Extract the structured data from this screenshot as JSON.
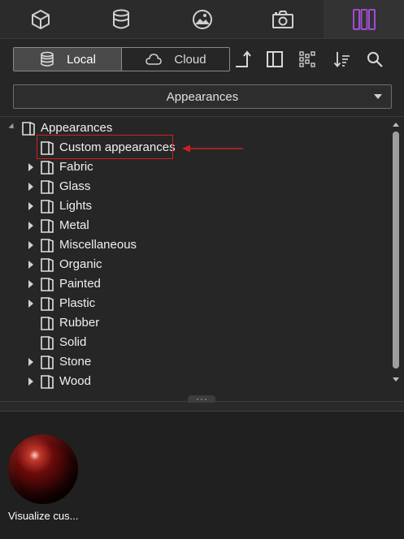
{
  "tabs": [
    {
      "name": "model-cube-icon",
      "active": false
    },
    {
      "name": "material-bucket-icon",
      "active": false
    },
    {
      "name": "environment-image-icon",
      "active": false
    },
    {
      "name": "camera-icon",
      "active": false
    },
    {
      "name": "library-books-icon",
      "active": true
    }
  ],
  "source_toggle": {
    "local_label": "Local",
    "cloud_label": "Cloud",
    "selected": "Local"
  },
  "toolbar": {
    "icons": [
      "go-up-icon",
      "panel-icon",
      "tree-view-icon",
      "sort-icon",
      "search-icon"
    ]
  },
  "library_dropdown": {
    "value": "Appearances"
  },
  "tree": {
    "root_label": "Appearances",
    "items": [
      {
        "label": "Custom appearances",
        "expandable": false,
        "highlighted": true
      },
      {
        "label": "Fabric",
        "expandable": true
      },
      {
        "label": "Glass",
        "expandable": true
      },
      {
        "label": "Lights",
        "expandable": true
      },
      {
        "label": "Metal",
        "expandable": true
      },
      {
        "label": "Miscellaneous",
        "expandable": true
      },
      {
        "label": "Organic",
        "expandable": true
      },
      {
        "label": "Painted",
        "expandable": true
      },
      {
        "label": "Plastic",
        "expandable": true
      },
      {
        "label": "Rubber",
        "expandable": false
      },
      {
        "label": "Solid",
        "expandable": false
      },
      {
        "label": "Stone",
        "expandable": true
      },
      {
        "label": "Wood",
        "expandable": true
      }
    ]
  },
  "preview": {
    "item_label": "Visualize cus..."
  },
  "colors": {
    "accent_active_tab": "#a24bd0",
    "annotation_red": "#d21f1f"
  }
}
